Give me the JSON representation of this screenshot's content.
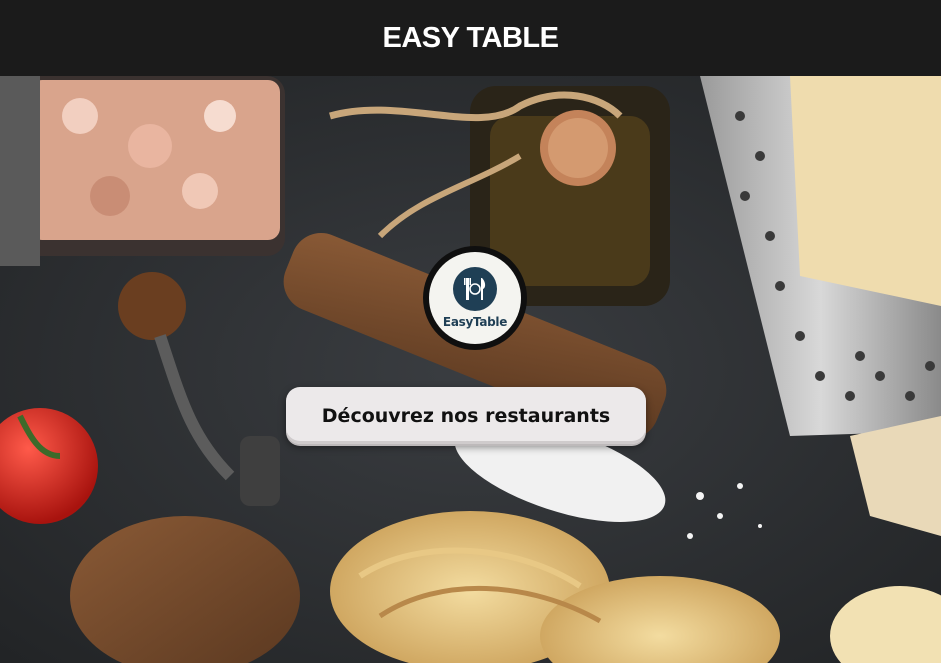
{
  "header": {
    "title": "EASY TABLE"
  },
  "hero": {
    "logo": {
      "text": "EasyTable"
    },
    "cta_label": "Découvrez nos restaurants"
  },
  "colors": {
    "header_bg": "#1b1b1b",
    "header_text": "#ffffff",
    "button_bg": "#ece9ea",
    "logo_accent": "#1f3f55"
  }
}
